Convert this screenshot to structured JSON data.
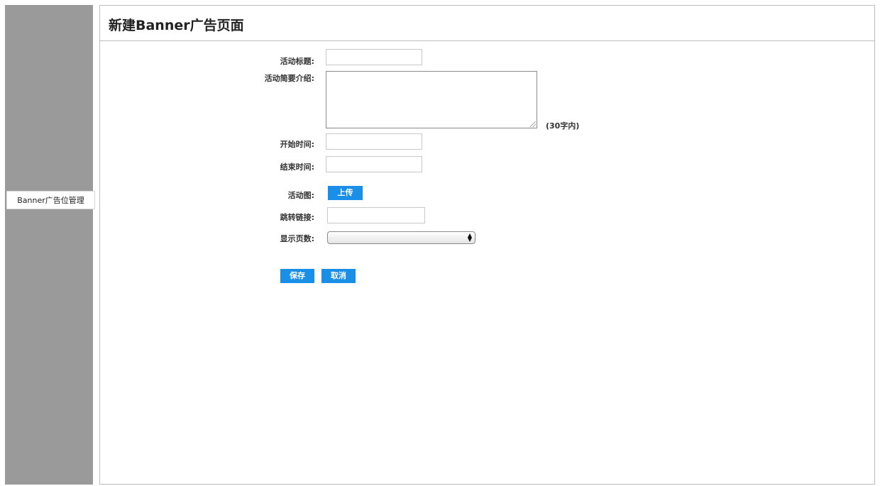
{
  "sidebar": {
    "items": [
      {
        "label": "Banner广告位管理"
      }
    ]
  },
  "header": {
    "title": "新建Banner广告页面"
  },
  "form": {
    "title_label": "活动标题:",
    "title_value": "",
    "summary_label": "活动简要介绍:",
    "summary_value": "",
    "summary_hint": "(30字内)",
    "start_label": "开始时间:",
    "start_value": "",
    "end_label": "结束时间:",
    "end_value": "",
    "image_label": "活动图:",
    "upload_label": "上传",
    "link_label": "跳转链接:",
    "link_value": "",
    "pages_label": "显示页数:",
    "pages_selected": ""
  },
  "actions": {
    "save_label": "保存",
    "cancel_label": "取消"
  },
  "colors": {
    "sidebar_bg": "#9a9a9a",
    "accent": "#1a8fe8"
  }
}
